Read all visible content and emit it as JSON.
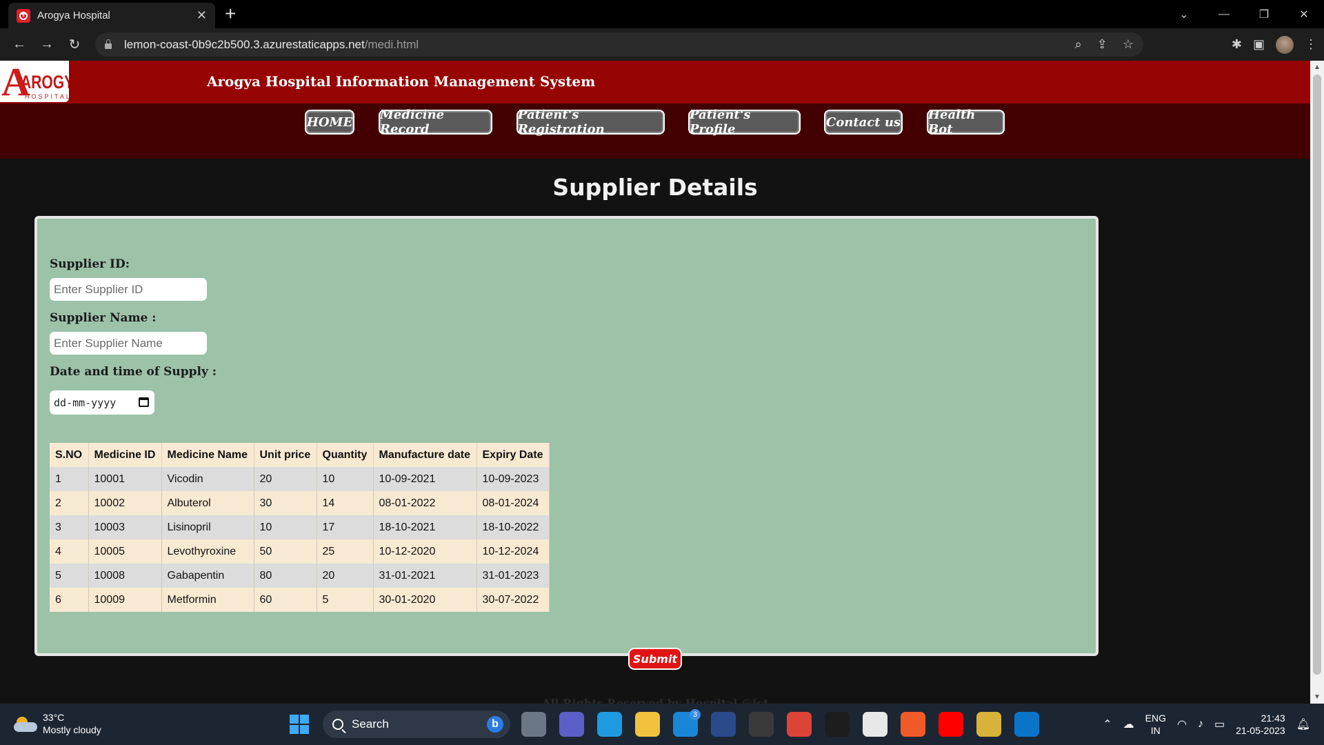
{
  "browser": {
    "tab_title": "Arogya Hospital",
    "tab_close": "✕",
    "new_tab": "+",
    "url_host": "lemon-coast-0b9c2b500.3.azurestaticapps.net",
    "url_path": "/medi.html",
    "controls": {
      "minimize": "—",
      "restore": "❐",
      "close": "✕",
      "tab_search": "⌄"
    },
    "nav": {
      "back": "←",
      "forward": "→",
      "reload": "↻"
    }
  },
  "site": {
    "logo_letter": "A",
    "logo_word": "AROGYA",
    "logo_sub": "HOSPITALS",
    "title": "Arogya Hospital Information Management System",
    "nav": [
      {
        "label": "HOME"
      },
      {
        "label": "Medicine Record"
      },
      {
        "label": "Patient's Registration"
      },
      {
        "label": "Patient's Profile"
      },
      {
        "label": "Contact us"
      },
      {
        "label": "Health Bot"
      }
    ]
  },
  "page": {
    "heading": "Supplier Details",
    "form": {
      "supplier_id_label": "Supplier ID:",
      "supplier_id_placeholder": "Enter Supplier ID",
      "supplier_name_label": "Supplier Name :",
      "supplier_name_placeholder": "Enter Supplier Name",
      "date_label": "Date and time of Supply :",
      "date_placeholder": "dd-mm-yyyy"
    },
    "table": {
      "headers": [
        "S.NO",
        "Medicine ID",
        "Medicine Name",
        "Unit price",
        "Quantity",
        "Manufacture date",
        "Expiry Date"
      ],
      "rows": [
        [
          "1",
          "10001",
          "Vicodin",
          "20",
          "10",
          "10-09-2021",
          "10-09-2023"
        ],
        [
          "2",
          "10002",
          "Albuterol",
          "30",
          "14",
          "08-01-2022",
          "08-01-2024"
        ],
        [
          "3",
          "10003",
          "Lisinopril",
          "10",
          "17",
          "18-10-2021",
          "18-10-2022"
        ],
        [
          "4",
          "10005",
          "Levothyroxine",
          "50",
          "25",
          "10-12-2020",
          "10-12-2024"
        ],
        [
          "5",
          "10008",
          "Gabapentin",
          "80",
          "20",
          "31-01-2021",
          "31-01-2023"
        ],
        [
          "6",
          "10009",
          "Metformin",
          "60",
          "5",
          "30-01-2020",
          "30-07-2022"
        ]
      ]
    },
    "submit_label": "Submit",
    "footer": "All Rights Reserved by Hospital @ict"
  },
  "taskbar": {
    "weather_temp": "33°C",
    "weather_desc": "Mostly cloudy",
    "search_label": "Search",
    "mail_badge": "3",
    "lang_top": "ENG",
    "lang_bottom": "IN",
    "time": "21:43",
    "date": "21-05-2023",
    "apps": [
      {
        "name": "task-view",
        "color": "#6b7785"
      },
      {
        "name": "teams",
        "color": "#5b5fc7"
      },
      {
        "name": "edge",
        "color": "#1e9be0"
      },
      {
        "name": "file-explorer",
        "color": "#f2c13d"
      },
      {
        "name": "mail",
        "color": "#1a86d8"
      },
      {
        "name": "devhome",
        "color": "#2b4a8c"
      },
      {
        "name": "terminal",
        "color": "#3a3a3a"
      },
      {
        "name": "chrome",
        "color": "#db4437"
      },
      {
        "name": "mysql",
        "color": "#1d1d1d"
      },
      {
        "name": "store",
        "color": "#e8e8e8"
      },
      {
        "name": "brave",
        "color": "#f05a28"
      },
      {
        "name": "youtube",
        "color": "#ff0000"
      },
      {
        "name": "chrome-profile",
        "color": "#d8b23a"
      },
      {
        "name": "vscode",
        "color": "#0a74c9"
      }
    ]
  }
}
